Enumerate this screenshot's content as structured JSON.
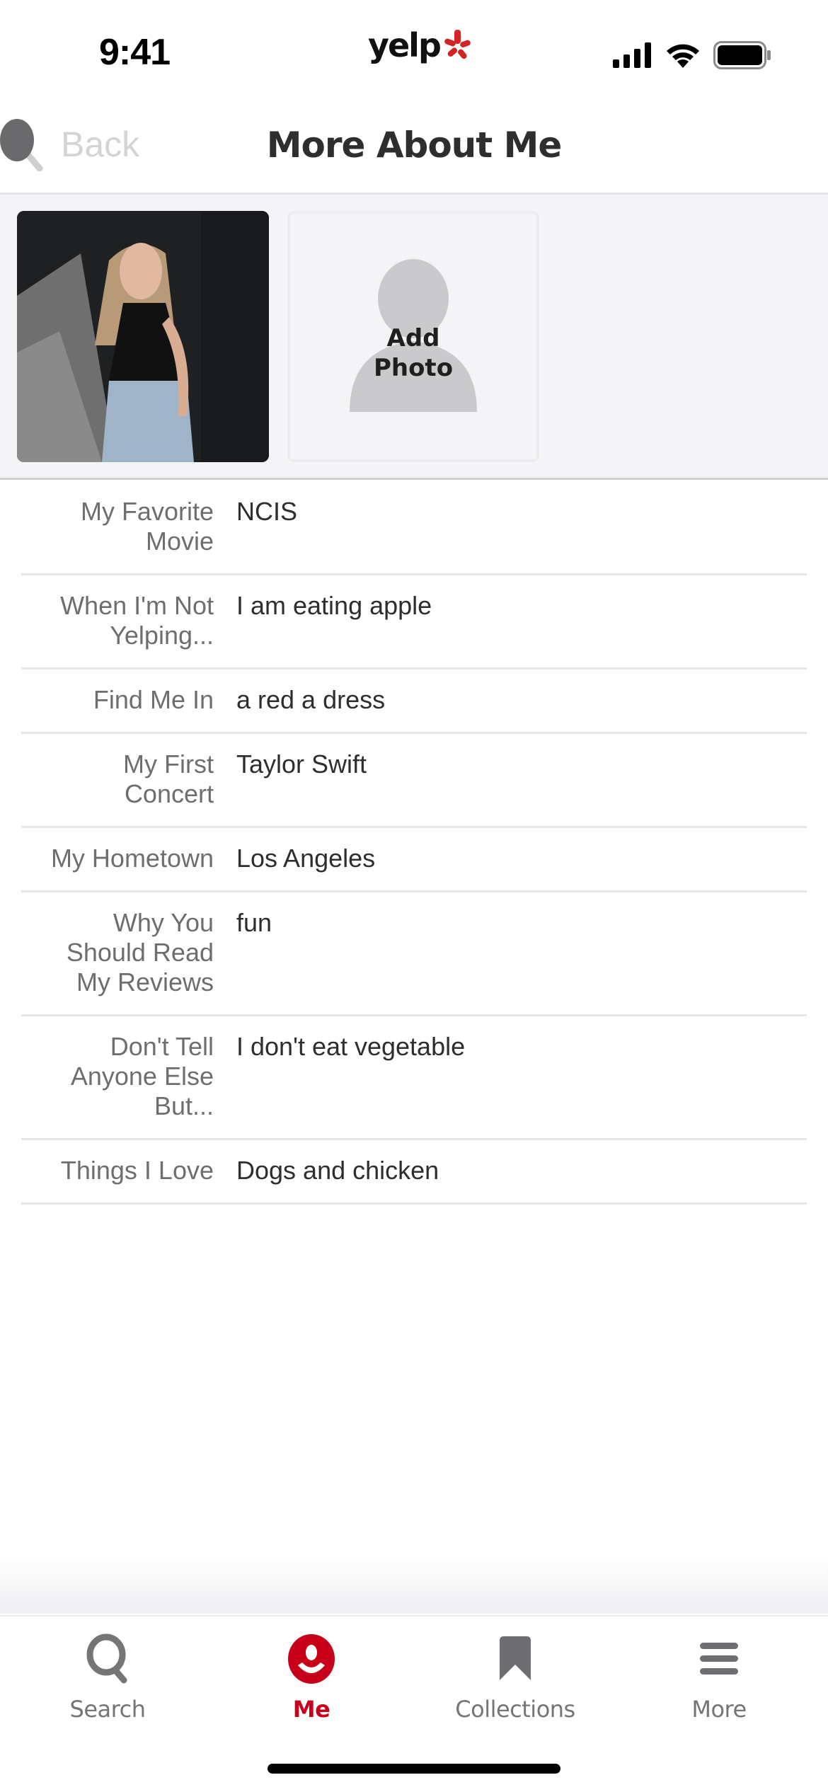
{
  "status_bar": {
    "time": "9:41",
    "logo_text": "yelp",
    "icons": [
      "signal-icon",
      "wifi-icon",
      "battery-icon"
    ]
  },
  "header": {
    "back_label": "Back",
    "title": "More About Me"
  },
  "photos": {
    "user_photo_alt": "Profile photo",
    "add_photo_label_line1": "Add",
    "add_photo_label_line2": "Photo"
  },
  "details": [
    {
      "label": "My Favorite Movie",
      "value": "NCIS"
    },
    {
      "label": "When I'm Not Yelping...",
      "value": "I am eating apple"
    },
    {
      "label": "Find Me In",
      "value": "a red a dress"
    },
    {
      "label": "My First Concert",
      "value": "Taylor Swift"
    },
    {
      "label": "My Hometown",
      "value": "Los Angeles"
    },
    {
      "label": "Why You Should Read My Reviews",
      "value": "fun"
    },
    {
      "label": "Don't Tell Anyone Else But...",
      "value": "I don't eat vegetable"
    },
    {
      "label": "Things I Love",
      "value": "Dogs and chicken"
    }
  ],
  "tabs": [
    {
      "label": "Search",
      "icon": "search-icon",
      "active": false
    },
    {
      "label": "Me",
      "icon": "me-icon",
      "active": true
    },
    {
      "label": "Collections",
      "icon": "bookmark-icon",
      "active": false
    },
    {
      "label": "More",
      "icon": "menu-icon",
      "active": false
    }
  ],
  "colors": {
    "brand_red": "#c8001a",
    "inactive_tab": "#757575",
    "label_gray": "#6e6e70",
    "divider": "#e6e6e8"
  }
}
